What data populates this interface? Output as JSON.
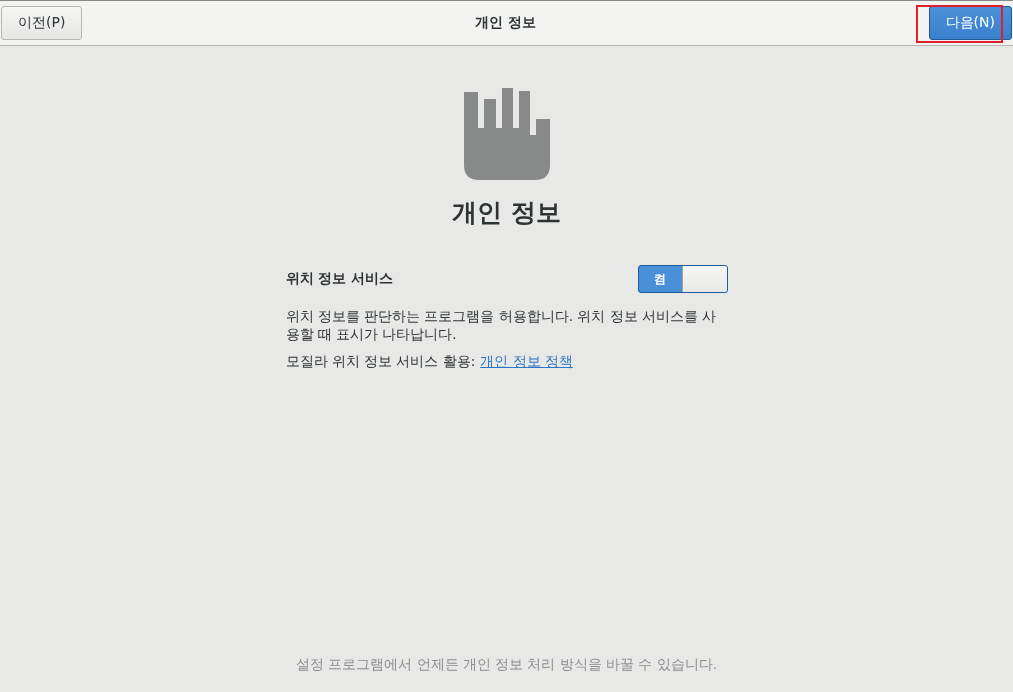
{
  "header": {
    "back_button": "이전(P)",
    "title": "개인 정보",
    "next_button": "다음(N)",
    "next_highlighted": true
  },
  "page": {
    "heading": "개인 정보",
    "location_service": {
      "label": "위치 정보 서비스",
      "switch_label": "켬",
      "on": true,
      "description": "위치 정보를 판단하는 프로그램을 허용합니다. 위치 정보 서비스를 사용할 때 표시가 나타납니다.",
      "provider_text": "모질라 위치 정보 서비스 활용:",
      "policy_link": "개인 정보 정책"
    }
  },
  "footer_note": "설정 프로그램에서 언제든 개인 정보 처리 방식을 바꿀 수 있습니다."
}
